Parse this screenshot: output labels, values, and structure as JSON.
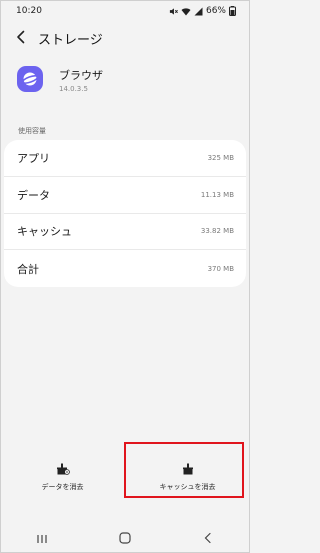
{
  "status_bar": {
    "time": "10:20",
    "battery": "66%"
  },
  "header": {
    "title": "ストレージ"
  },
  "app": {
    "name": "ブラウザ",
    "version": "14.0.3.5",
    "icon_color": "#6c63ef"
  },
  "section": {
    "label": "使用容量"
  },
  "storage_rows": [
    {
      "label": "アプリ",
      "value": "325 MB"
    },
    {
      "label": "データ",
      "value": "11.13 MB"
    },
    {
      "label": "キャッシュ",
      "value": "33.82 MB"
    },
    {
      "label": "合計",
      "value": "370 MB"
    }
  ],
  "actions": {
    "clear_data": "データを消去",
    "clear_cache": "キャッシュを消去"
  },
  "colors": {
    "highlight": "#e0141c",
    "background": "#f3f3f3"
  }
}
